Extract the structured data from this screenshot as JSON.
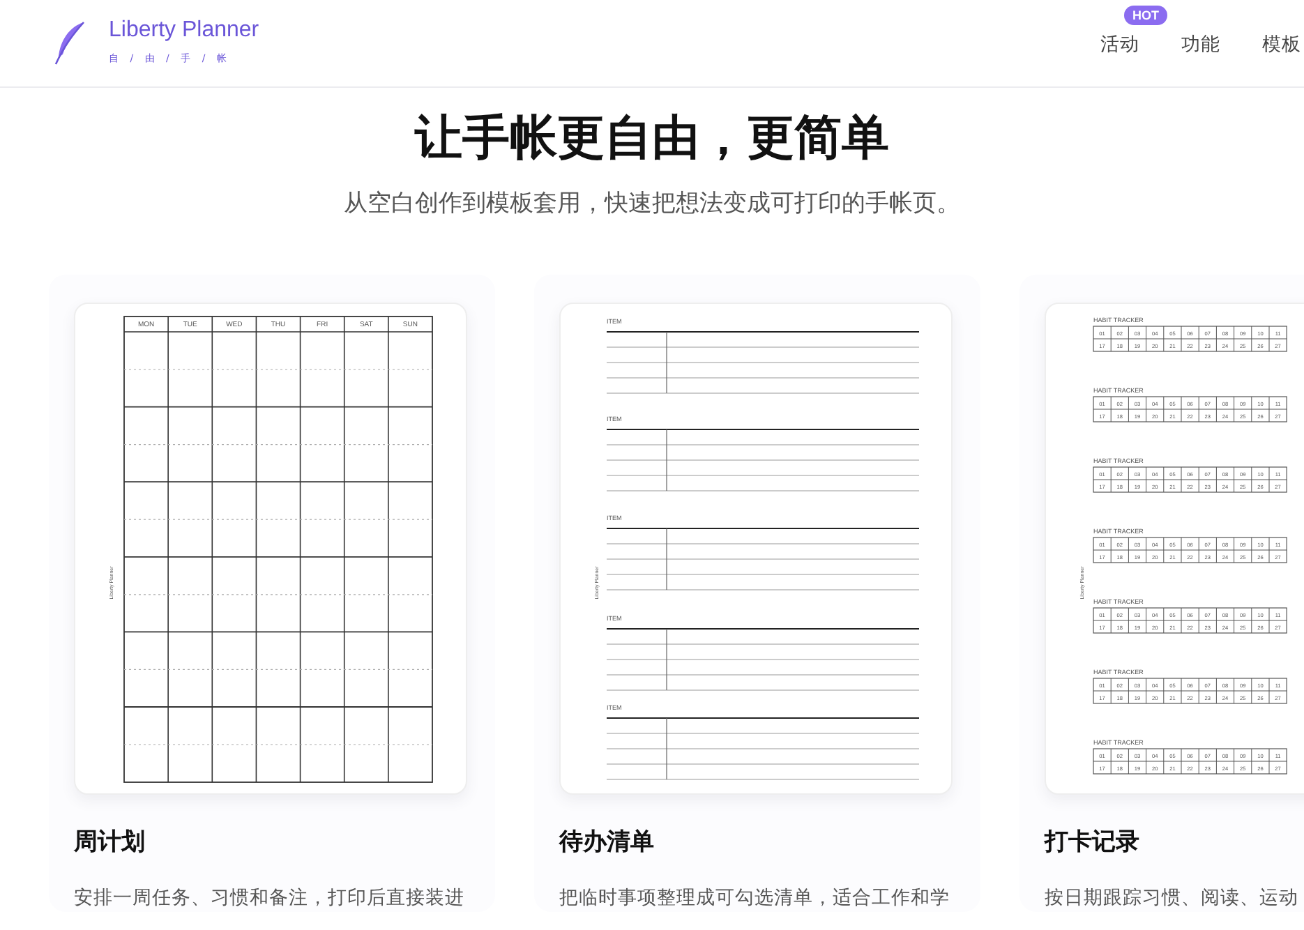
{
  "header": {
    "logo_title": "Liberty Planner",
    "logo_subtitle": "自 / 由 / 手 / 帐",
    "nav": [
      {
        "label": "活动",
        "badge": "HOT"
      },
      {
        "label": "功能"
      },
      {
        "label": "模板"
      }
    ]
  },
  "hero": {
    "title": "让手帐更自由，更简单",
    "subtitle": "从空白创作到模板套用，快速把想法变成可打印的手帐页。"
  },
  "cards": [
    {
      "title": "周计划",
      "description": "安排一周任务、习惯和备注，打印后直接装进",
      "preview": {
        "kind": "weekly",
        "side_label": "Liberty Planner",
        "days": [
          "MON",
          "TUE",
          "WED",
          "THU",
          "FRI",
          "SAT",
          "SUN"
        ]
      }
    },
    {
      "title": "待办清单",
      "description": "把临时事项整理成可勾选清单，适合工作和学",
      "preview": {
        "kind": "todo",
        "side_label": "Liberty Planner",
        "sections": [
          "ITEM",
          "ITEM",
          "ITEM",
          "ITEM",
          "ITEM"
        ]
      }
    },
    {
      "title": "打卡记录",
      "description": "按日期跟踪习惯、阅读、运动",
      "preview": {
        "kind": "habit",
        "side_label": "Liberty Planner",
        "trackers": [
          {
            "title": "HABIT TRACKER",
            "row_1": [
              "01",
              "02",
              "03",
              "04",
              "05",
              "06",
              "07",
              "08",
              "09",
              "10",
              "11"
            ],
            "row_2": [
              "17",
              "18",
              "19",
              "20",
              "21",
              "22",
              "23",
              "24",
              "25",
              "26",
              "27"
            ]
          },
          {
            "title": "HABIT TRACKER",
            "row_1": [
              "01",
              "02",
              "03",
              "04",
              "05",
              "06",
              "07",
              "08",
              "09",
              "10",
              "11"
            ],
            "row_2": [
              "17",
              "18",
              "19",
              "20",
              "21",
              "22",
              "23",
              "24",
              "25",
              "26",
              "27"
            ]
          },
          {
            "title": "HABIT TRACKER",
            "row_1": [
              "01",
              "02",
              "03",
              "04",
              "05",
              "06",
              "07",
              "08",
              "09",
              "10",
              "11"
            ],
            "row_2": [
              "17",
              "18",
              "19",
              "20",
              "21",
              "22",
              "23",
              "24",
              "25",
              "26",
              "27"
            ]
          },
          {
            "title": "HABIT TRACKER",
            "row_1": [
              "01",
              "02",
              "03",
              "04",
              "05",
              "06",
              "07",
              "08",
              "09",
              "10",
              "11"
            ],
            "row_2": [
              "17",
              "18",
              "19",
              "20",
              "21",
              "22",
              "23",
              "24",
              "25",
              "26",
              "27"
            ]
          },
          {
            "title": "HABIT TRACKER",
            "row_1": [
              "01",
              "02",
              "03",
              "04",
              "05",
              "06",
              "07",
              "08",
              "09",
              "10",
              "11"
            ],
            "row_2": [
              "17",
              "18",
              "19",
              "20",
              "21",
              "22",
              "23",
              "24",
              "25",
              "26",
              "27"
            ]
          },
          {
            "title": "HABIT TRACKER",
            "row_1": [
              "01",
              "02",
              "03",
              "04",
              "05",
              "06",
              "07",
              "08",
              "09",
              "10",
              "11"
            ],
            "row_2": [
              "17",
              "18",
              "19",
              "20",
              "21",
              "22",
              "23",
              "24",
              "25",
              "26",
              "27"
            ]
          },
          {
            "title": "HABIT TRACKER",
            "row_1": [
              "01",
              "02",
              "03",
              "04",
              "05",
              "06",
              "07",
              "08",
              "09",
              "10",
              "11"
            ],
            "row_2": [
              "17",
              "18",
              "19",
              "20",
              "21",
              "22",
              "23",
              "24",
              "25",
              "26",
              "27"
            ]
          }
        ]
      }
    }
  ]
}
